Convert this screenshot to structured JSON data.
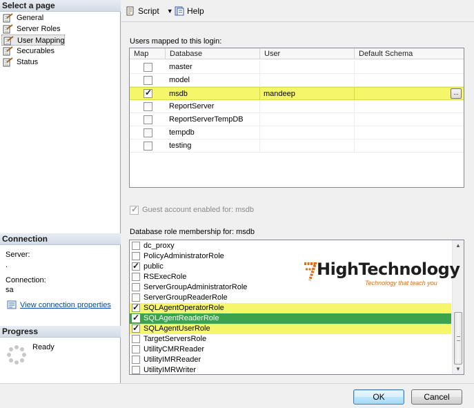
{
  "left_panel": {
    "select_page_header": "Select a page",
    "pages": [
      {
        "label": "General"
      },
      {
        "label": "Server Roles"
      },
      {
        "label": "User Mapping"
      },
      {
        "label": "Securables"
      },
      {
        "label": "Status"
      }
    ],
    "connection_header": "Connection",
    "server_label": "Server:",
    "server_value": ".",
    "connection_label": "Connection:",
    "connection_value": "sa",
    "view_connection_link": "View connection properties",
    "progress_header": "Progress",
    "progress_status": "Ready"
  },
  "toolbar": {
    "script_label": "Script",
    "help_label": "Help"
  },
  "users_grid": {
    "caption": "Users mapped to this login:",
    "columns": [
      "Map",
      "Database",
      "User",
      "Default Schema"
    ],
    "rows": [
      {
        "map": false,
        "database": "master",
        "user": "",
        "schema": ""
      },
      {
        "map": false,
        "database": "model",
        "user": "",
        "schema": ""
      },
      {
        "map": true,
        "database": "msdb",
        "user": "mandeep",
        "schema": "",
        "highlight": true
      },
      {
        "map": false,
        "database": "ReportServer",
        "user": "",
        "schema": ""
      },
      {
        "map": false,
        "database": "ReportServerTempDB",
        "user": "",
        "schema": ""
      },
      {
        "map": false,
        "database": "tempdb",
        "user": "",
        "schema": ""
      },
      {
        "map": false,
        "database": "testing",
        "user": "",
        "schema": ""
      }
    ],
    "ellipsis_label": "..."
  },
  "guest": {
    "label": "Guest account enabled for: msdb",
    "checked": true
  },
  "roles": {
    "caption": "Database role membership for: msdb",
    "items": [
      {
        "label": "dc_proxy",
        "checked": false
      },
      {
        "label": "PolicyAdministratorRole",
        "checked": false
      },
      {
        "label": "public",
        "checked": true
      },
      {
        "label": "RSExecRole",
        "checked": false
      },
      {
        "label": "ServerGroupAdministratorRole",
        "checked": false
      },
      {
        "label": "ServerGroupReaderRole",
        "checked": false
      },
      {
        "label": "SQLAgentOperatorRole",
        "checked": true,
        "state": "hl"
      },
      {
        "label": "SQLAgentReaderRole",
        "checked": true,
        "state": "sel"
      },
      {
        "label": "SQLAgentUserRole",
        "checked": true,
        "state": "hl"
      },
      {
        "label": "TargetServersRole",
        "checked": false
      },
      {
        "label": "UtilityCMRReader",
        "checked": false
      },
      {
        "label": "UtilityIMRReader",
        "checked": false
      },
      {
        "label": "UtilityIMRWriter",
        "checked": false
      }
    ]
  },
  "logo": {
    "main": "HighTechnology",
    "tagline": "Technology that teach you"
  },
  "buttons": {
    "ok": "OK",
    "cancel": "Cancel"
  },
  "colors": {
    "highlight_yellow": "#f6f66b",
    "selected_green": "#3da34a",
    "logo_orange": "#e06c12"
  }
}
